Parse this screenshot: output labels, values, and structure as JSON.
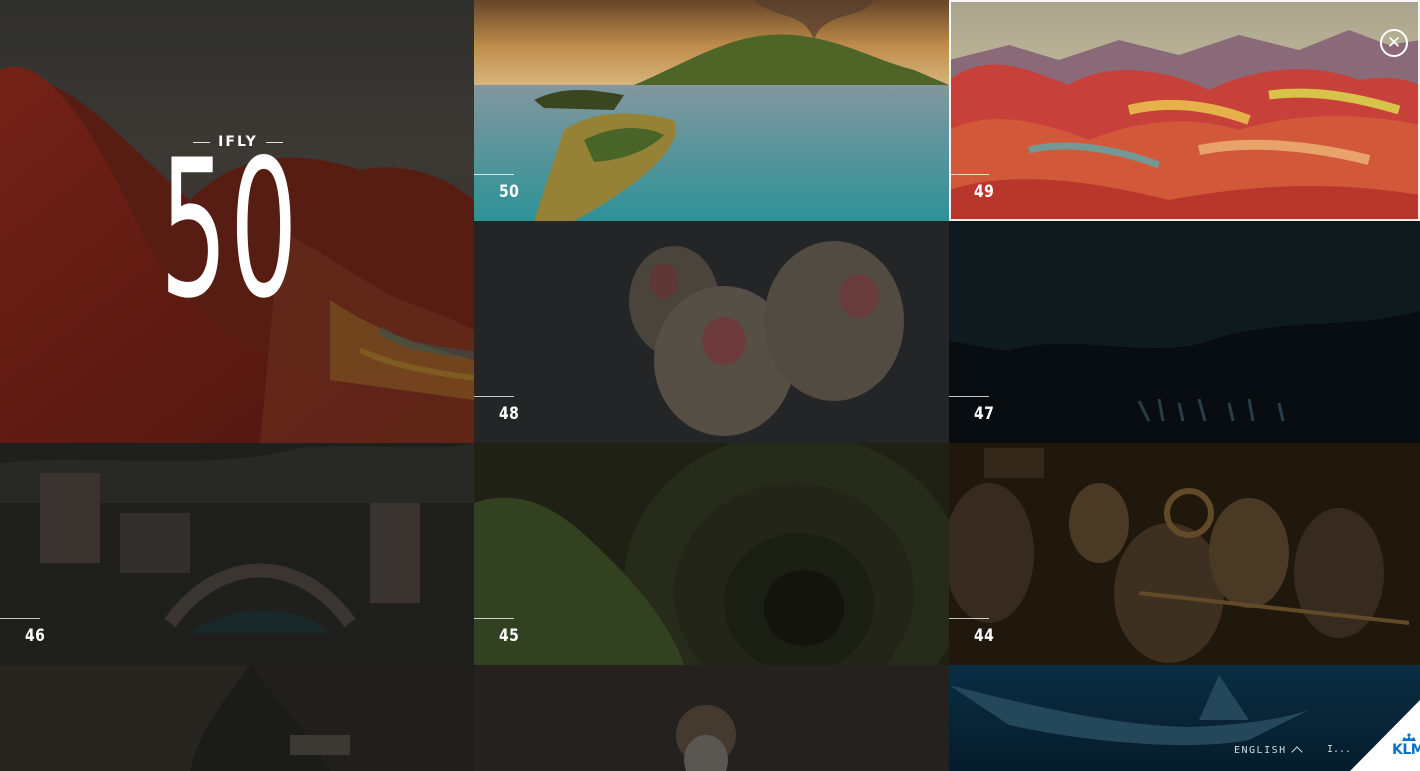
{
  "hero": {
    "label": "IFLY",
    "number": "50"
  },
  "tiles": [
    {
      "number": "50",
      "theme": "volcano-island",
      "selected": false
    },
    {
      "number": "49",
      "theme": "rainbow-mountains",
      "selected": true
    },
    {
      "number": "48",
      "theme": "snow-monkeys",
      "selected": false
    },
    {
      "number": "47",
      "theme": "dark-cave",
      "selected": false
    },
    {
      "number": "46",
      "theme": "old-town-bridge",
      "selected": false
    },
    {
      "number": "45",
      "theme": "spiral-well",
      "selected": false
    },
    {
      "number": "44",
      "theme": "jazz-band",
      "selected": false
    },
    {
      "number": "",
      "theme": "coastal-cliffs",
      "selected": false
    },
    {
      "number": "",
      "theme": "bearded-man",
      "selected": false
    },
    {
      "number": "",
      "theme": "shark-underwater",
      "selected": false
    }
  ],
  "footer": {
    "language": "ENGLISH",
    "more": "I...",
    "brand": "KLM"
  },
  "icons": {
    "close": "close-circle-icon",
    "language_toggle": "chevron-up-icon",
    "brand": "klm-crown-logo"
  },
  "colors": {
    "klm_blue": "#0a73c9",
    "text": "#ffffff",
    "footer_text": "#d6dbe0"
  }
}
